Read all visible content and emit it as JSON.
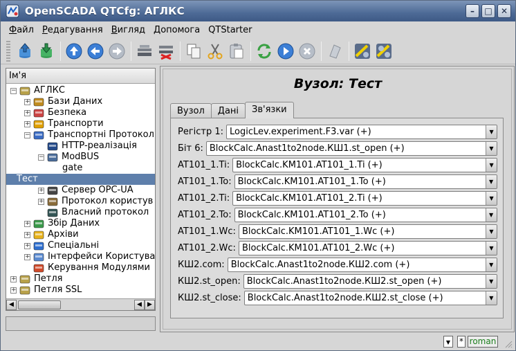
{
  "window": {
    "title": "OpenSCADA QTCfg: АГЛКС",
    "controls": [
      "minimize-button",
      "maximize-button",
      "close-button"
    ]
  },
  "menu": [
    {
      "label": "Файл",
      "ul": "Ф",
      "rest": "айл"
    },
    {
      "label": "Редагування",
      "ul": "Р",
      "rest": "едагування"
    },
    {
      "label": "Вигляд",
      "ul": "В",
      "rest": "игляд"
    },
    {
      "label": "Допомога",
      "ul": "Д",
      "rest": "опомога"
    },
    {
      "label": "QTStarter",
      "ul": "",
      "rest": "QTStarter"
    }
  ],
  "toolbar": {
    "buttons": [
      "load-db-icon",
      "save-db-icon",
      "up-icon",
      "back-icon",
      "forward-icon",
      "add-item-icon",
      "delete-item-icon",
      "copy-icon",
      "cut-icon",
      "paste-icon",
      "refresh-icon",
      "start-icon",
      "stop-icon",
      "info-icon",
      "module-icon",
      "module-alt-icon"
    ]
  },
  "tree": {
    "header": "Ім'я",
    "nodes": [
      {
        "label": "АГЛКС",
        "level": 0,
        "expanded": true,
        "icon": "station-icon"
      },
      {
        "label": "Бази Даних",
        "level": 1,
        "expanded": false,
        "icon": "database-icon"
      },
      {
        "label": "Безпека",
        "level": 1,
        "expanded": false,
        "icon": "security-icon"
      },
      {
        "label": "Транспорти",
        "level": 1,
        "expanded": false,
        "icon": "transport-icon"
      },
      {
        "label": "Транспортні Протокол",
        "level": 1,
        "expanded": true,
        "icon": "protocol-icon"
      },
      {
        "label": "HTTP-реалізація",
        "level": 2,
        "expanded": null,
        "icon": "http-icon"
      },
      {
        "label": "ModBUS",
        "level": 2,
        "expanded": true,
        "icon": "modbus-icon"
      },
      {
        "label": "gate",
        "level": 3,
        "expanded": null,
        "icon": ""
      },
      {
        "label": "Тест",
        "level": 3,
        "expanded": null,
        "icon": "",
        "selected": true
      },
      {
        "label": "Сервер OPC-UA",
        "level": 2,
        "expanded": false,
        "icon": "opcua-icon"
      },
      {
        "label": "Протокол користув",
        "level": 2,
        "expanded": false,
        "icon": "user-protocol-icon"
      },
      {
        "label": "Власний протокол",
        "level": 2,
        "expanded": null,
        "icon": "own-protocol-icon"
      },
      {
        "label": "Збір Даних",
        "level": 1,
        "expanded": false,
        "icon": "daq-icon"
      },
      {
        "label": "Архіви",
        "level": 1,
        "expanded": false,
        "icon": "archive-icon"
      },
      {
        "label": "Спеціальні",
        "level": 1,
        "expanded": false,
        "icon": "special-icon"
      },
      {
        "label": "Інтерфейси Користува",
        "level": 1,
        "expanded": false,
        "icon": "ui-icon"
      },
      {
        "label": "Керування Модулями",
        "level": 1,
        "expanded": null,
        "icon": "modules-icon"
      },
      {
        "label": "Петля",
        "level": 0,
        "expanded": false,
        "icon": "station-icon"
      },
      {
        "label": "Петля SSL",
        "level": 0,
        "expanded": false,
        "icon": "station-icon"
      }
    ]
  },
  "content": {
    "title": "Вузол: Тест",
    "tabs": [
      {
        "label": "Вузол",
        "active": false
      },
      {
        "label": "Дані",
        "active": false
      },
      {
        "label": "Зв'язки",
        "active": true
      }
    ],
    "links": [
      {
        "label": "Регістр 1:",
        "value": "LogicLev.experiment.F3.var (+)"
      },
      {
        "label": "Біт 6:",
        "value": "BlockCalc.Anast1to2node.КШ1.st_open (+)"
      },
      {
        "label": "AT101_1.Ti:",
        "value": "BlockCalc.KM101.AT101_1.Ti (+)"
      },
      {
        "label": "AT101_1.To:",
        "value": "BlockCalc.KM101.AT101_1.To (+)"
      },
      {
        "label": "AT101_2.Ti:",
        "value": "BlockCalc.KM101.AT101_2.Ti (+)"
      },
      {
        "label": "AT101_2.To:",
        "value": "BlockCalc.KM101.AT101_2.To (+)"
      },
      {
        "label": "AT101_1.Wc:",
        "value": "BlockCalc.KM101.AT101_1.Wc (+)"
      },
      {
        "label": "AT101_2.Wc:",
        "value": "BlockCalc.KM101.AT101_2.Wc (+)"
      },
      {
        "label": "КШ2.com:",
        "value": "BlockCalc.Anast1to2node.КШ2.com (+)"
      },
      {
        "label": "КШ2.st_open:",
        "value": "BlockCalc.Anast1to2node.КШ2.st_open (+)"
      },
      {
        "label": "КШ2.st_close:",
        "value": "BlockCalc.Anast1to2node.КШ2.st_close (+)"
      }
    ]
  },
  "status": {
    "indicator": "*",
    "language": "roman"
  }
}
